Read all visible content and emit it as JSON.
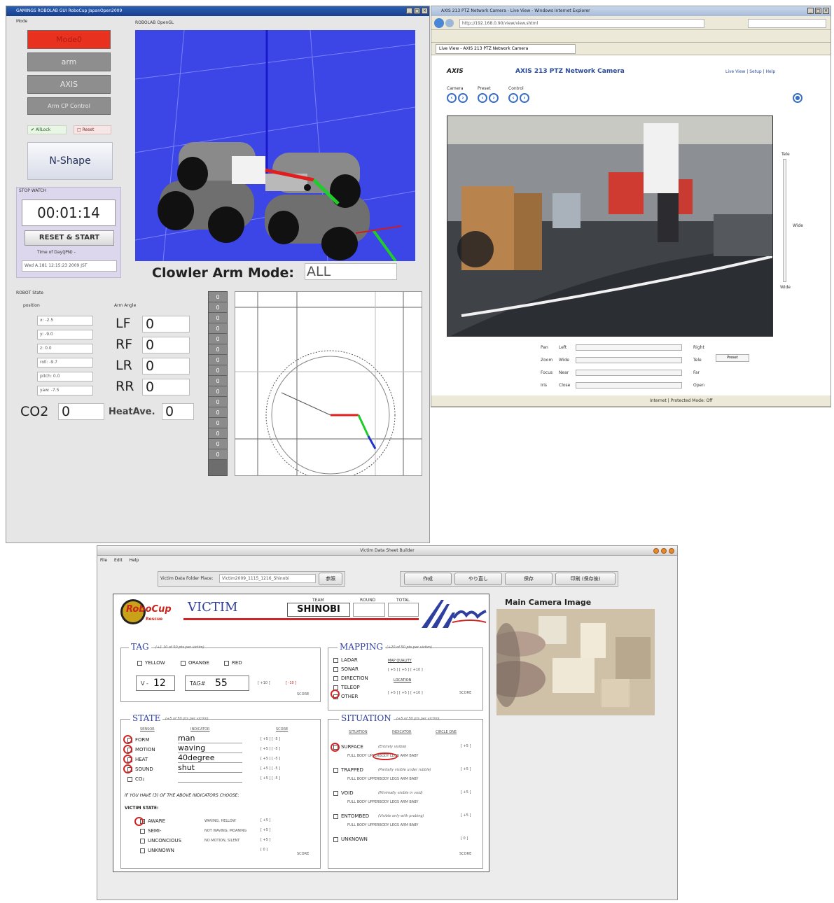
{
  "robot_window": {
    "title": "GAMINGS ROBOLAB GUI RoboCup JapanOpen2009",
    "left_panel_label": "Mode",
    "buttons": [
      "Mode0",
      "arm",
      "AXIS",
      "Arm CP Control"
    ],
    "toggles": [
      "AllLock",
      "Reset"
    ],
    "nshape_label": "N-Shape",
    "stopwatch_label": "STOP WATCH",
    "timer": "00:01:14",
    "reset_start_label": "RESET & START",
    "time_label": "Time of Day(JPN) -",
    "time_value": "Wed A.181 12:15:23 2009 JST",
    "view_label": "ROBOLAB OpenGL",
    "arm_mode_label": "Clowler Arm Mode:",
    "arm_mode_value": "ALL",
    "status_label": "ROBOT State",
    "position_label": "position",
    "position_values": [
      "x: -2.5",
      "y: -9.0",
      "z: 0.0",
      "roll: -9.7",
      "pitch: 0.0",
      "yaw: -7.5"
    ],
    "arm_angle_label": "Arm Angle",
    "arm_angles": [
      {
        "name": "LF",
        "value": "0"
      },
      {
        "name": "RF",
        "value": "0"
      },
      {
        "name": "LR",
        "value": "0"
      },
      {
        "name": "RR",
        "value": "0"
      }
    ],
    "co2_label": "CO2",
    "co2_value": "0",
    "heat_label": "HeatAve.",
    "heat_value": "0",
    "column_values": [
      "0",
      "0",
      "0",
      "0",
      "0",
      "0",
      "0",
      "0",
      "0",
      "0",
      "0",
      "0",
      "0",
      "0",
      "0",
      "0"
    ]
  },
  "camera_window": {
    "title": "AXIS 213 PTZ Network Camera - Live View - Windows Internet Explorer",
    "address": "http://192.168.0.90/view/view.shtml",
    "tab_label": "Live View - AXIS 213 PTZ Network Camera",
    "brand": "AXIS",
    "camera_title": "AXIS 213 PTZ Network Camera",
    "links": "Live View | Setup | Help",
    "ctrl_groups": [
      "Camera",
      "Preset",
      "Control"
    ],
    "ctrl_rows": [
      {
        "label": "Pan",
        "left": "Left",
        "right": "Right"
      },
      {
        "label": "Zoom",
        "left": "Wide",
        "right": "Tele"
      },
      {
        "label": "Focus",
        "left": "Near",
        "right": "Far"
      },
      {
        "label": "Iris",
        "left": "Close",
        "right": "Open"
      }
    ],
    "preset_button": "Preset",
    "right_labels": [
      "Tele",
      "Wide"
    ],
    "status": "Internet | Protected Mode: Off"
  },
  "victim_window": {
    "title": "Victim Data Sheet Builder",
    "menu": [
      "File",
      "Edit",
      "Help"
    ],
    "folder_label": "Victim Data Folder Place:",
    "folder_value": "Victim2009_1115_1216_Shinobi",
    "folder_button": "参照",
    "action_buttons": [
      "作成",
      "やり直し",
      "保存",
      "印刷 (保存後)"
    ],
    "sheet_brand": "RoboCup",
    "sheet_brand_sub": "Rescue",
    "sheet_title": "VICTIM",
    "team_label": "TEAM",
    "team_value": "SHINOBI",
    "round_label": "ROUND",
    "total_label": "TOTAL",
    "tag_title": "TAG",
    "tag_note": "(+1 10 of 50 pts per victim)",
    "tag_colors": [
      "YELLOW",
      "ORANGE",
      "RED"
    ],
    "victim_no_label": "V -",
    "victim_no": "12",
    "tag_no_label": "TAG#",
    "tag_no": "55",
    "tag_scores": [
      "[ +10 ]",
      "[ -10 ]"
    ],
    "score_word": "SCORE",
    "mapping_title": "MAPPING",
    "mapping_note": "(+20 of 50 pts per victim)",
    "mapping_items": [
      "LADAR",
      "SONAR",
      "DIRECTION",
      "TELEOP",
      "OTHER"
    ],
    "mapping_labels": [
      "MAP QUALITY",
      "LOCATION"
    ],
    "mapping_scores": [
      "[ +5 ] [ +5 ] [ +10 ]",
      "[ +5 ] [ +5 ] [ +10 ]"
    ],
    "state_title": "STATE",
    "state_note": "(+5 of 50 pts per victim)",
    "state_headers": [
      "SENSOR",
      "INDICATOR",
      "SCORE"
    ],
    "state_rows": [
      {
        "sensor": "FORM",
        "value": "man",
        "score": "[ +5 ] [ -5 ]"
      },
      {
        "sensor": "MOTION",
        "value": "waving",
        "score": "[ +5 ] [ -5 ]"
      },
      {
        "sensor": "HEAT",
        "value": "40degree",
        "score": "[ +5 ] [ -5 ]"
      },
      {
        "sensor": "SOUND",
        "value": "shut",
        "score": "[ +5 ] [ -5 ]"
      },
      {
        "sensor": "CO₂",
        "value": "",
        "score": "[ +5 ] [ -5 ]"
      }
    ],
    "state_footnote": "IF YOU HAVE (3) OF THE ABOVE INDICATORS CHOOSE:",
    "victim_state_label": "VICTIM STATE:",
    "victim_states": [
      {
        "name": "AWARE",
        "note": "WAVING, HELLOW",
        "score": "[ +5 ]"
      },
      {
        "name": "SEMI-",
        "note": "NOT WAVING, MOANING",
        "score": "[ +5 ]"
      },
      {
        "name": "UNCONCIOUS",
        "note": "NO MOTION, SILENT",
        "score": "[ +5 ]"
      },
      {
        "name": "UNKNOWN",
        "note": "",
        "score": "[ 0 ]"
      }
    ],
    "situation_title": "SITUATION",
    "situation_note": "(+5 of 50 pts per victim)",
    "situation_headers": [
      "SITUATION",
      "INDICATOR",
      "CIRCLE ONE"
    ],
    "situation_rows": [
      {
        "name": "SURFACE",
        "note": "(Entirely visible)",
        "opts": "FULL BODY  UPPERBODY  LEGS  ARM  BABY",
        "score": "[ +5 ]"
      },
      {
        "name": "TRAPPED",
        "note": "(Partially visible under rubble)",
        "opts": "FULL BODY  UPPERBODY  LEGS  ARM  BABY",
        "score": "[ +5 ]"
      },
      {
        "name": "VOID",
        "note": "(Minimally visible in void)",
        "opts": "FULL BODY  UPPERBODY  LEGS  ARM  BABY",
        "score": "[ +5 ]"
      },
      {
        "name": "ENTOMBED",
        "note": "(Visible only with probing)",
        "opts": "FULL BODY  UPPERBODY  LEGS  ARM  BABY",
        "score": "[ +5 ]"
      },
      {
        "name": "UNKNOWN",
        "note": "",
        "opts": "",
        "score": "[ 0 ]"
      }
    ],
    "main_camera_label": "Main Camera Image"
  }
}
